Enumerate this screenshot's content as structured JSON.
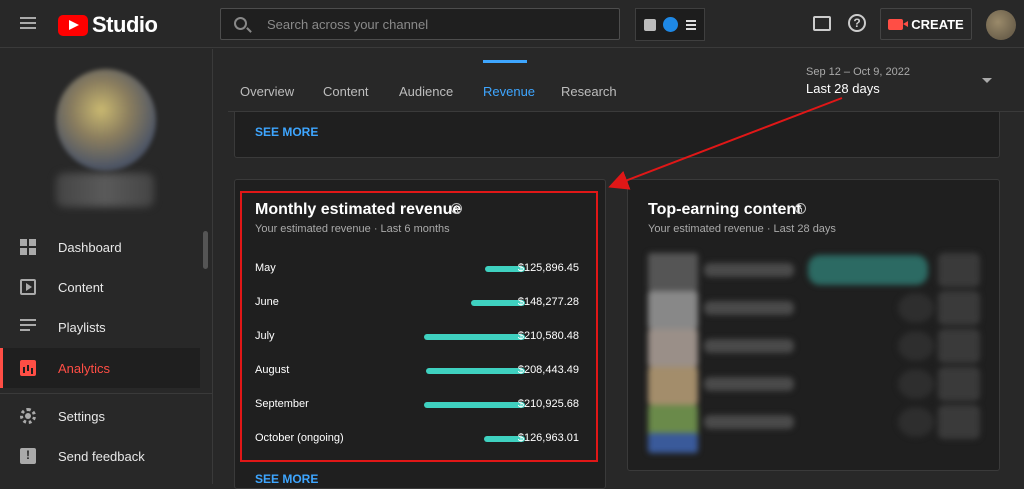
{
  "header": {
    "logo_text": "Studio",
    "search_placeholder": "Search across your channel",
    "create_label": "CREATE"
  },
  "sidebar": {
    "items": [
      {
        "label": "Dashboard",
        "icon": "dashboard-icon"
      },
      {
        "label": "Content",
        "icon": "content-icon"
      },
      {
        "label": "Playlists",
        "icon": "playlists-icon"
      },
      {
        "label": "Analytics",
        "icon": "analytics-icon",
        "active": true
      },
      {
        "label": "Settings",
        "icon": "gear-icon"
      },
      {
        "label": "Send feedback",
        "icon": "feedback-icon"
      }
    ]
  },
  "tabs": [
    {
      "label": "Overview"
    },
    {
      "label": "Content"
    },
    {
      "label": "Audience"
    },
    {
      "label": "Revenue",
      "active": true
    },
    {
      "label": "Research"
    }
  ],
  "date": {
    "range": "Sep 12 – Oct 9, 2022",
    "label": "Last 28 days"
  },
  "top_card": {
    "see_more": "SEE MORE"
  },
  "monthly_revenue": {
    "title": "Monthly estimated revenue",
    "subtitle": "Your estimated revenue · Last 6 months",
    "rows": [
      {
        "month": "May",
        "value": "$125,896.45",
        "amount": 125896.45
      },
      {
        "month": "June",
        "value": "$148,277.28",
        "amount": 148277.28
      },
      {
        "month": "July",
        "value": "$210,580.48",
        "amount": 210580.48
      },
      {
        "month": "August",
        "value": "$208,443.49",
        "amount": 208443.49
      },
      {
        "month": "September",
        "value": "$210,925.68",
        "amount": 210925.68
      },
      {
        "month": "October (ongoing)",
        "value": "$126,963.01",
        "amount": 126963.01
      }
    ],
    "see_more": "SEE MORE",
    "bar_color": "#3fd1c0"
  },
  "top_earning": {
    "title": "Top-earning content",
    "subtitle": "Your estimated revenue · Last 28 days"
  },
  "colors": {
    "accent_red": "#ff4e45",
    "link_blue": "#3ea6ff",
    "highlight_red": "#e01717"
  }
}
